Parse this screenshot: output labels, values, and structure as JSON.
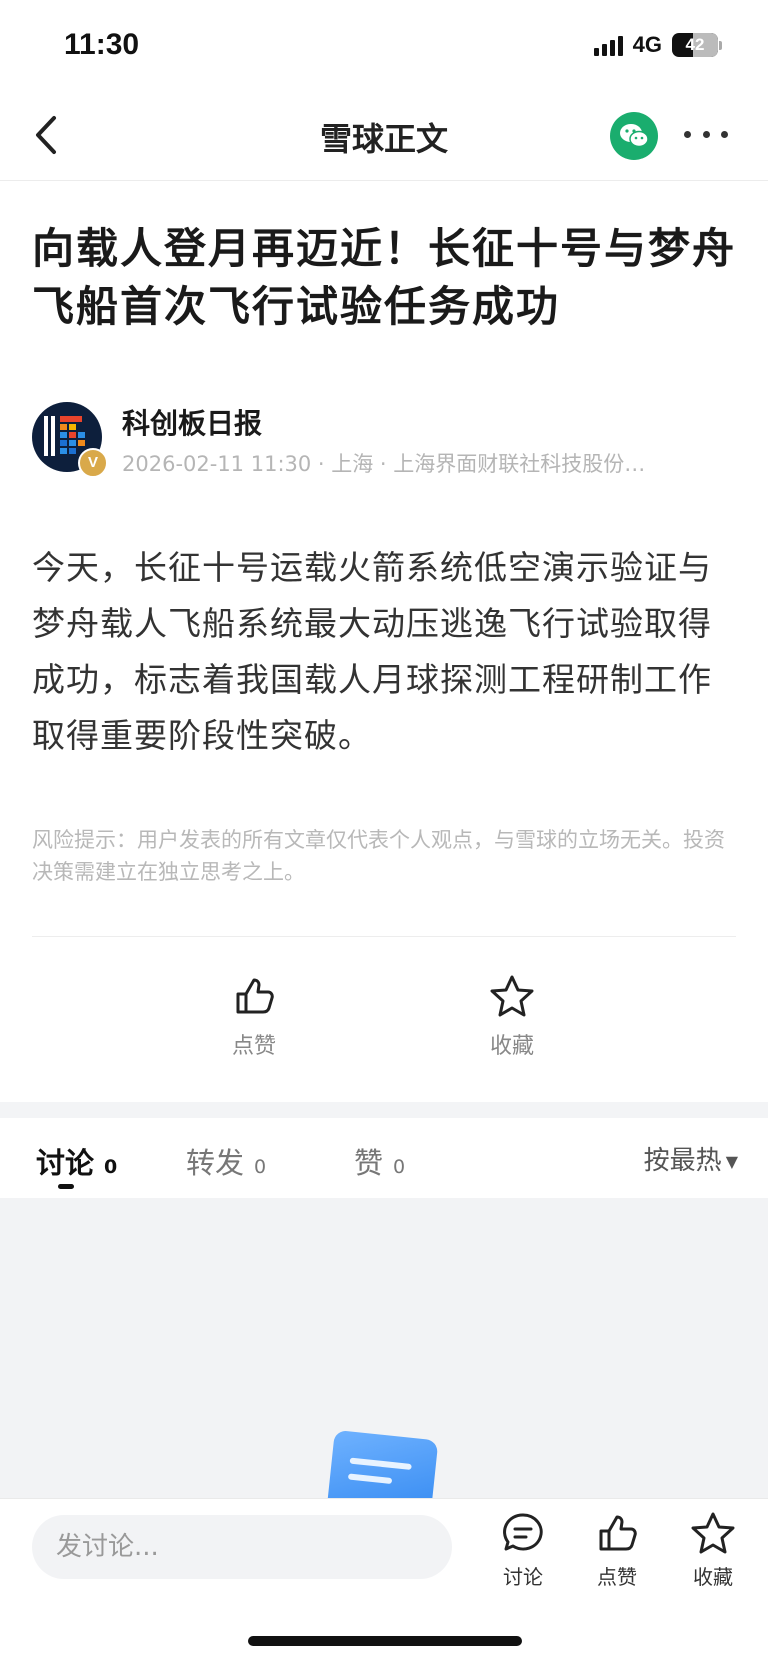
{
  "status_bar": {
    "time": "11:30",
    "network": "4G",
    "battery": "42"
  },
  "nav": {
    "title": "雪球正文"
  },
  "article": {
    "title": "向载人登月再迈近！长征十号与梦舟飞船首次飞行试验任务成功",
    "author": "科创板日报",
    "verified_badge": "V",
    "meta": "2026-02-11 11:30 · 上海 · 上海界面财联社科技股份…",
    "body": "今天，长征十号运载火箭系统低空演示验证与梦舟载人飞船系统最大动压逃逸飞行试验取得成功，标志着我国载人月球探测工程研制工作取得重要阶段性突破。",
    "risk_notice": "风险提示：用户发表的所有文章仅代表个人观点，与雪球的立场无关。投资决策需建立在独立思考之上。"
  },
  "actions": {
    "like_label": "点赞",
    "favorite_label": "收藏"
  },
  "tabs": [
    {
      "label": "讨论",
      "count": "0"
    },
    {
      "label": "转发",
      "count": "0"
    },
    {
      "label": "赞",
      "count": "0"
    }
  ],
  "sort_label": "按最热",
  "bottom_bar": {
    "input_placeholder": "发讨论...",
    "discuss_label": "讨论",
    "like_label": "点赞",
    "favorite_label": "收藏"
  },
  "colors": {
    "wechat_green": "#1aad6e",
    "verified_gold": "#d9a94a",
    "accent_blue": "#2f86f0"
  }
}
